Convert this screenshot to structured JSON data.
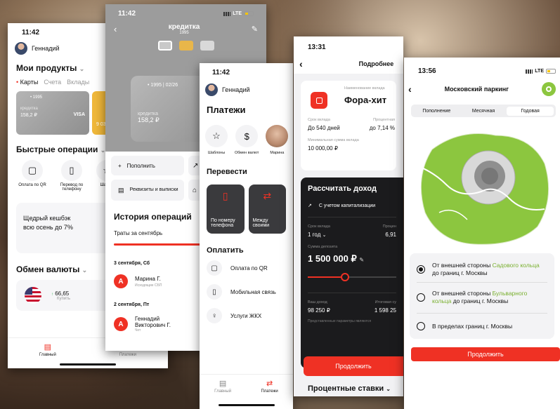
{
  "p1": {
    "time": "11:42",
    "user": "Геннадий",
    "products_title": "Мои продукты",
    "tabs": [
      "Карты",
      "Счета",
      "Вклады"
    ],
    "card1": {
      "num": "• 1995",
      "text": "кредитка",
      "amount": "158,2 ₽",
      "brand": "VISA"
    },
    "card2": {
      "amount": "9 03"
    },
    "quick_title": "Быстрые операции",
    "quick": [
      {
        "label": "Оплата по QR"
      },
      {
        "label": "Перевод по телефону"
      },
      {
        "label": "Шабло"
      }
    ],
    "promo": "Щедрый кешбэк всю осень до 7%",
    "fx_title": "Обмен валюты",
    "fx_value": "66,65",
    "fx_sub": "Купить",
    "tabs_bottom": [
      "Главный",
      "Платежи"
    ]
  },
  "p2": {
    "time": "11:42",
    "title": "кредитка",
    "subtitle": "1995",
    "card_num": "• 1995 | 02/26",
    "card_text": "кредитка",
    "card_amount": "158,2 ₽",
    "action1": "Пополнить",
    "action2": "Реквизиты и выписки",
    "history_title": "История операций",
    "spend_label": "Траты за сентябрь",
    "date1": "3 сентября, Сб",
    "op1_name": "Марина Г.",
    "op1_sub": "Исходящие СБП",
    "date2": "2 сентября, Пт",
    "op2_name": "Геннадий Викторович Г.",
    "op2_sub": "Чет"
  },
  "p3": {
    "time": "11:42",
    "user": "Геннадий",
    "title": "Платежи",
    "circles": [
      {
        "label": "Шаблоны"
      },
      {
        "label": "Обмен валют"
      },
      {
        "label": "Марина"
      }
    ],
    "transfer_title": "Перевести",
    "t1": "По номеру телефона",
    "t2": "Между своими",
    "pay_title": "Оплатить",
    "pay": [
      {
        "label": "Оплата по QR"
      },
      {
        "label": "Мобильная связь"
      },
      {
        "label": "Услуги ЖКХ"
      }
    ],
    "tabs": [
      "Главный",
      "Платежи"
    ]
  },
  "p4": {
    "time": "13:31",
    "title": "Подробнее",
    "deposit_label": "Наименование вклада",
    "deposit_name": "Фора-хит",
    "term_label": "Срок вклада",
    "term_value": "До 540 дней",
    "rate_label": "Процентная",
    "rate_value": "до 7,14 %",
    "min_label": "Минимальная сумма вклада",
    "min_value": "10 000,00 ₽",
    "calc_title": "Рассчитать доход",
    "cap_label": "С учетом капитализации",
    "term2_label": "Срок вклада",
    "term2_value": "1 год",
    "rate2_label": "Процен",
    "rate2_value": "6,91",
    "sum_label": "Сумма депозита",
    "sum_value": "1 500 000 ₽",
    "income_label": "Ваш доход",
    "income_value": "98 250 ₽",
    "total_label": "Итоговая су",
    "total_value": "1 598 25",
    "fine_print": "Представленные параметры являются",
    "button": "Продолжить",
    "bottom_title": "Процентные ставки",
    "slider_fraction": 0.42
  },
  "p5": {
    "time": "13:56",
    "title": "Московский паркинг",
    "tabs": [
      "Пополнение",
      "Месячная",
      "Годовая"
    ],
    "options": [
      {
        "before": "От внешней стороны ",
        "accent": "Садового кольца",
        "after": " до границ г. Москвы",
        "selected": true
      },
      {
        "before": "От внешней стороны ",
        "accent": "Бульварного кольца",
        "after": " до границ г. Москвы",
        "selected": false
      },
      {
        "before": "В пределах границ г. Москвы",
        "accent": "",
        "after": "",
        "selected": false
      }
    ],
    "button": "Продолжить"
  },
  "colors": {
    "accent": "#ef3124",
    "green": "#8cc63f",
    "dark": "#1b1b1d"
  }
}
